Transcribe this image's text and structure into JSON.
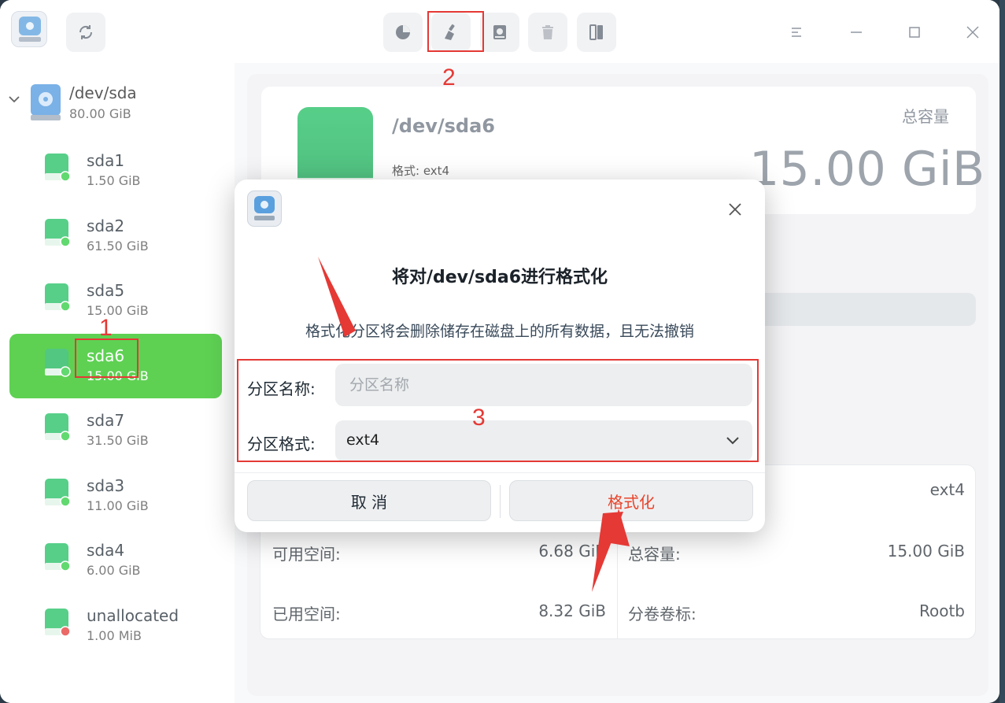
{
  "toolbar": {
    "buttons": [
      {
        "name": "partition-pie-icon"
      },
      {
        "name": "format-broom-icon"
      },
      {
        "name": "disk-info-icon"
      },
      {
        "name": "delete-icon"
      },
      {
        "name": "split-icon"
      }
    ]
  },
  "sidebar": {
    "disk": {
      "name": "/dev/sda",
      "size": "80.00 GiB"
    },
    "partitions": [
      {
        "name": "sda1",
        "size": "1.50 GiB",
        "badge": "#2ecc40"
      },
      {
        "name": "sda2",
        "size": "61.50 GiB",
        "badge": "#2ecc40"
      },
      {
        "name": "sda5",
        "size": "15.00 GiB",
        "badge": "#2ecc40"
      },
      {
        "name": "sda6",
        "size": "15.00 GiB",
        "badge": "#2ecc40",
        "selected": true
      },
      {
        "name": "sda7",
        "size": "31.50 GiB",
        "badge": "#2ecc40"
      },
      {
        "name": "sda3",
        "size": "11.00 GiB",
        "badge": "#2ecc40"
      },
      {
        "name": "sda4",
        "size": "6.00 GiB",
        "badge": "#2ecc40"
      },
      {
        "name": "unallocated",
        "size": "1.00 MiB",
        "badge": "#e53935"
      }
    ]
  },
  "main": {
    "partition_name": "/dev/sda6",
    "format_label": "格式: ext4",
    "total_label": "总容量",
    "total_value": "15.00 GiB",
    "info": {
      "fs_value": "ext4",
      "free_label": "可用空间:",
      "free_value": "6.68 GiB",
      "used_label": "已用空间:",
      "used_value": "8.32 GiB",
      "cap_label": "总容量:",
      "cap_value": "15.00 GiB",
      "vol_label": "分卷卷标:",
      "vol_value": "Rootb"
    }
  },
  "dialog": {
    "title": "将对/dev/sda6进行格式化",
    "message": "格式化分区将会删除储存在磁盘上的所有数据，且无法撤销",
    "name_label": "分区名称:",
    "name_placeholder": "分区名称",
    "format_label": "分区格式:",
    "format_value": "ext4",
    "cancel": "取 消",
    "confirm": "格式化",
    "confirm_color": "#e8452c"
  },
  "annotations": {
    "one": "1",
    "two": "2",
    "three": "3",
    "color": "#e53935"
  }
}
